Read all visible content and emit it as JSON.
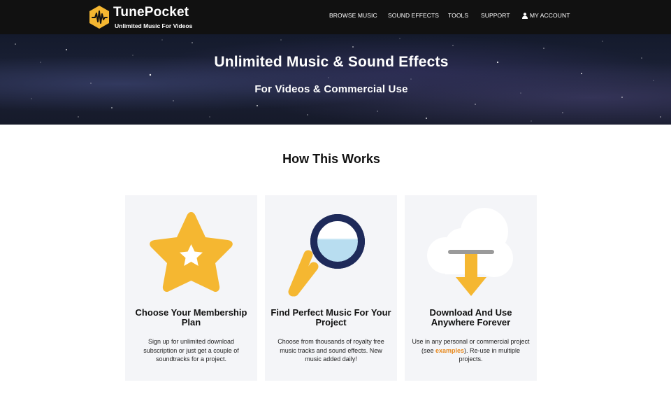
{
  "header": {
    "brand_name": "TunePocket",
    "brand_tagline": "Unlimited Music For Videos",
    "logo_icon": "waveform-hexagon-icon",
    "nav": {
      "browse": "BROWSE MUSIC",
      "sound_effects": "SOUND EFFECTS",
      "tools": "TOOLS",
      "support": "SUPPORT",
      "account": "MY ACCOUNT",
      "account_icon": "user-icon"
    }
  },
  "hero": {
    "title": "Unlimited Music & Sound Effects",
    "subtitle": "For Videos & Commercial Use"
  },
  "how_it_works": {
    "title": "How This Works",
    "steps": [
      {
        "icon": "star-icon",
        "title": "Choose Your Membership Plan",
        "body": "Sign up for unlimited download subscription or just get a couple of soundtracks for a project."
      },
      {
        "icon": "magnifier-icon",
        "title": "Find Perfect Music For Your Project",
        "body": "Choose from thousands of royalty free music tracks and sound effects. New music added daily!"
      },
      {
        "icon": "cloud-download-icon",
        "title": "Download And Use Anywhere Forever",
        "body_before": "Use in any personal or commercial project (see ",
        "link": "examples",
        "body_after": "). Re-use in multiple projects."
      }
    ]
  },
  "colors": {
    "header_bg": "#111111",
    "accent_yellow": "#f5b731",
    "link_orange": "#e7891d",
    "card_bg": "#f4f5f8",
    "magnifier_navy": "#1e2a5a",
    "lens_blue": "#b8ddf0"
  }
}
